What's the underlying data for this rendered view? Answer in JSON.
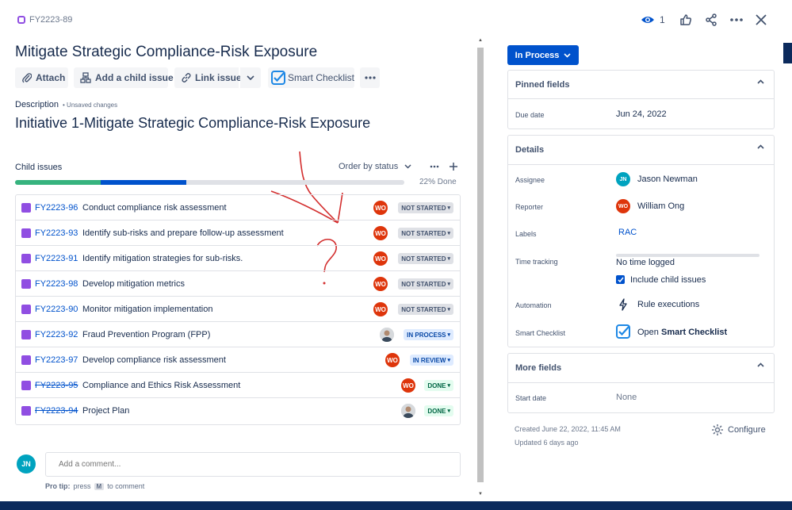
{
  "header": {
    "issue_key": "FY2223-89",
    "watch_count": "1"
  },
  "title": "Mitigate Strategic Compliance-Risk Exposure",
  "toolbar": {
    "attach": "Attach",
    "add_child": "Add a child issue",
    "link_issue": "Link issue",
    "smart_checklist": "Smart Checklist"
  },
  "description": {
    "label": "Description",
    "unsaved": "• Unsaved changes",
    "heading": "Initiative 1-Mitigate Strategic Compliance-Risk Exposure"
  },
  "child_issues": {
    "label": "Child issues",
    "order_by": "Order by status",
    "progress_text": "22% Done",
    "progress": {
      "done_fraction": 0.22,
      "in_progress_fraction": 0.22
    },
    "rows": [
      {
        "key": "FY2223-96",
        "summary": "Conduct compliance risk assessment",
        "assignee": "WO",
        "status": "NOT STARTED",
        "done": false
      },
      {
        "key": "FY2223-93",
        "summary": "Identify sub-risks and prepare follow-up assessment",
        "assignee": "WO",
        "status": "NOT STARTED",
        "done": false
      },
      {
        "key": "FY2223-91",
        "summary": "Identify mitigation strategies for sub-risks.",
        "assignee": "WO",
        "status": "NOT STARTED",
        "done": false
      },
      {
        "key": "FY2223-98",
        "summary": "Develop mitigation metrics",
        "assignee": "WO",
        "status": "NOT STARTED",
        "done": false
      },
      {
        "key": "FY2223-90",
        "summary": "Monitor mitigation implementation",
        "assignee": "WO",
        "status": "NOT STARTED",
        "done": false
      },
      {
        "key": "FY2223-92",
        "summary": "Fraud Prevention Program (FPP)",
        "assignee": "",
        "status": "IN PROCESS",
        "done": false
      },
      {
        "key": "FY2223-97",
        "summary": "Develop compliance risk assessment",
        "assignee": "WO",
        "status": "IN REVIEW",
        "done": false
      },
      {
        "key": "FY2223-95",
        "summary": "Compliance and Ethics Risk Assessment",
        "assignee": "WO",
        "status": "DONE",
        "done": true
      },
      {
        "key": "FY2223-94",
        "summary": "Project Plan",
        "assignee": "",
        "status": "DONE",
        "done": true
      }
    ]
  },
  "comment": {
    "avatar": "JN",
    "placeholder": "Add a comment...",
    "pro_tip_prefix": "Pro tip:",
    "pro_tip_press": "press",
    "pro_tip_key": "M",
    "pro_tip_suffix": "to comment"
  },
  "status_button": "In Process",
  "pinned": {
    "title": "Pinned fields",
    "due_label": "Due date",
    "due_value": "Jun 24, 2022"
  },
  "details": {
    "title": "Details",
    "assignee_label": "Assignee",
    "assignee_initials": "JN",
    "assignee_name": "Jason Newman",
    "reporter_label": "Reporter",
    "reporter_initials": "WO",
    "reporter_name": "William Ong",
    "labels_label": "Labels",
    "labels_value": "RAC",
    "time_label": "Time tracking",
    "time_value": "No time logged",
    "include_child": "Include child issues",
    "automation_label": "Automation",
    "automation_value": "Rule executions",
    "checklist_label": "Smart Checklist",
    "checklist_prefix": "Open",
    "checklist_value": "Smart Checklist"
  },
  "more_fields": {
    "title": "More fields",
    "start_label": "Start date",
    "start_value": "None"
  },
  "footer": {
    "created": "Created June 22, 2022, 11:45 AM",
    "updated": "Updated 6 days ago",
    "configure": "Configure"
  },
  "colors": {
    "accent": "#0052cc",
    "done_green": "#36b37e",
    "story_purple": "#904ee2",
    "avatar_red": "#de350b",
    "annotation_red": "#d32f2f"
  }
}
